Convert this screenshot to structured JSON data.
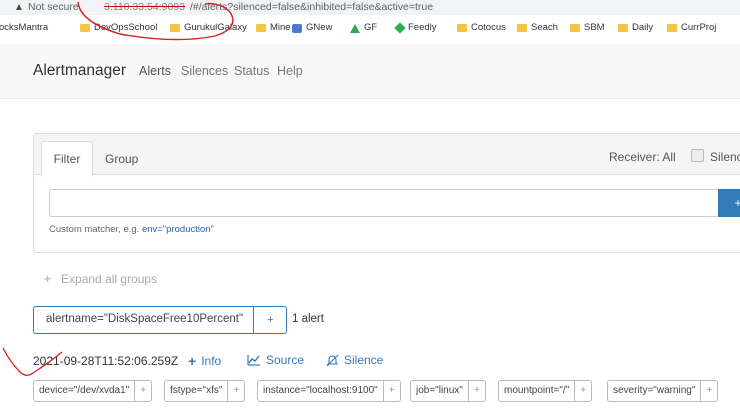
{
  "browser": {
    "security_label": "Not secure",
    "url_host": "3.110.33.54:9093",
    "url_path": "/#/alerts?silenced=false&inhibited=false&active=true"
  },
  "bookmarks": [
    "ocksMantra",
    "DevOpsSchool",
    "GurukulGalaxy",
    "Mine",
    "GNew",
    "GF",
    "Feedly",
    "Cotocus",
    "Seach",
    "SBM",
    "Daily",
    "CurrProj"
  ],
  "nav": {
    "brand": "Alertmanager",
    "links": [
      "Alerts",
      "Silences",
      "Status",
      "Help"
    ]
  },
  "filter_panel": {
    "tabs": [
      "Filter",
      "Group"
    ],
    "receiver_label": "Receiver: All",
    "silenced_label": "Silenced",
    "input_value": "",
    "add_button": "+",
    "hint_prefix": "Custom matcher, e.g.",
    "hint_example": "env=\"production\""
  },
  "expand_all": "Expand all groups",
  "group": {
    "label": "alertname=\"DiskSpaceFree10Percent\"",
    "plus": "+",
    "count": "1 alert"
  },
  "alert": {
    "timestamp": "2021-09-28T11:52:06.259Z",
    "actions": [
      "Info",
      "Source",
      "Silence"
    ],
    "labels": [
      "device=\"/dev/xvda1\"",
      "fstype=\"xfs\"",
      "instance=\"localhost:9100\"",
      "job=\"linux\"",
      "mountpoint=\"/\"",
      "severity=\"warning\""
    ],
    "label_plus": "+"
  },
  "colors": {
    "link": "#337ab7",
    "annotation": "#d42020"
  }
}
